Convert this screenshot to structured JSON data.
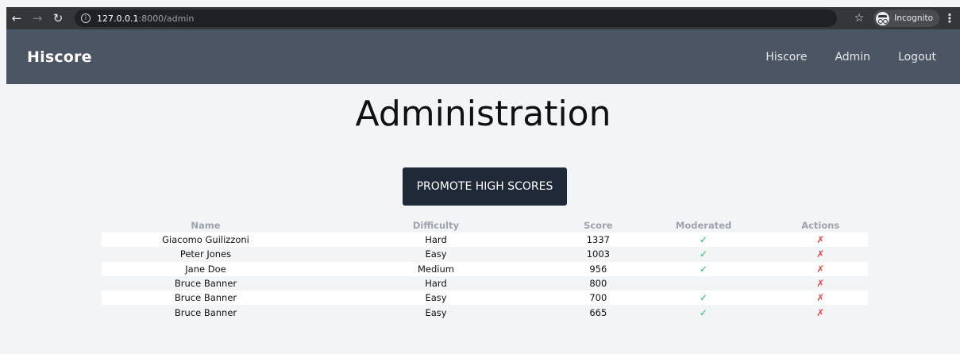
{
  "browser": {
    "url_host": "127.0.0.1",
    "url_path": ":8000/admin",
    "incognito_label": "Incognito"
  },
  "header": {
    "brand": "Hiscore",
    "nav": [
      "Hiscore",
      "Admin",
      "Logout"
    ]
  },
  "main": {
    "title": "Administration",
    "promote_button": "PROMOTE HIGH SCORES",
    "table": {
      "headers": [
        "Name",
        "Difficulty",
        "Score",
        "Moderated",
        "Actions"
      ],
      "rows": [
        {
          "name": "Giacomo Guilizzoni",
          "difficulty": "Hard",
          "score": "1337",
          "moderated": "✓",
          "action": "✗"
        },
        {
          "name": "Peter Jones",
          "difficulty": "Easy",
          "score": "1003",
          "moderated": "✓",
          "action": "✗"
        },
        {
          "name": "Jane Doe",
          "difficulty": "Medium",
          "score": "956",
          "moderated": "✓",
          "action": "✗"
        },
        {
          "name": "Bruce Banner",
          "difficulty": "Hard",
          "score": "800",
          "moderated": "",
          "action": "✗"
        },
        {
          "name": "Bruce Banner",
          "difficulty": "Easy",
          "score": "700",
          "moderated": "✓",
          "action": "✗"
        },
        {
          "name": "Bruce Banner",
          "difficulty": "Easy",
          "score": "665",
          "moderated": "✓",
          "action": "✗"
        }
      ]
    }
  },
  "colors": {
    "header_bg": "#4b5563",
    "button_bg": "#1f2937",
    "check": "#22c55e",
    "delete": "#ef4444"
  }
}
